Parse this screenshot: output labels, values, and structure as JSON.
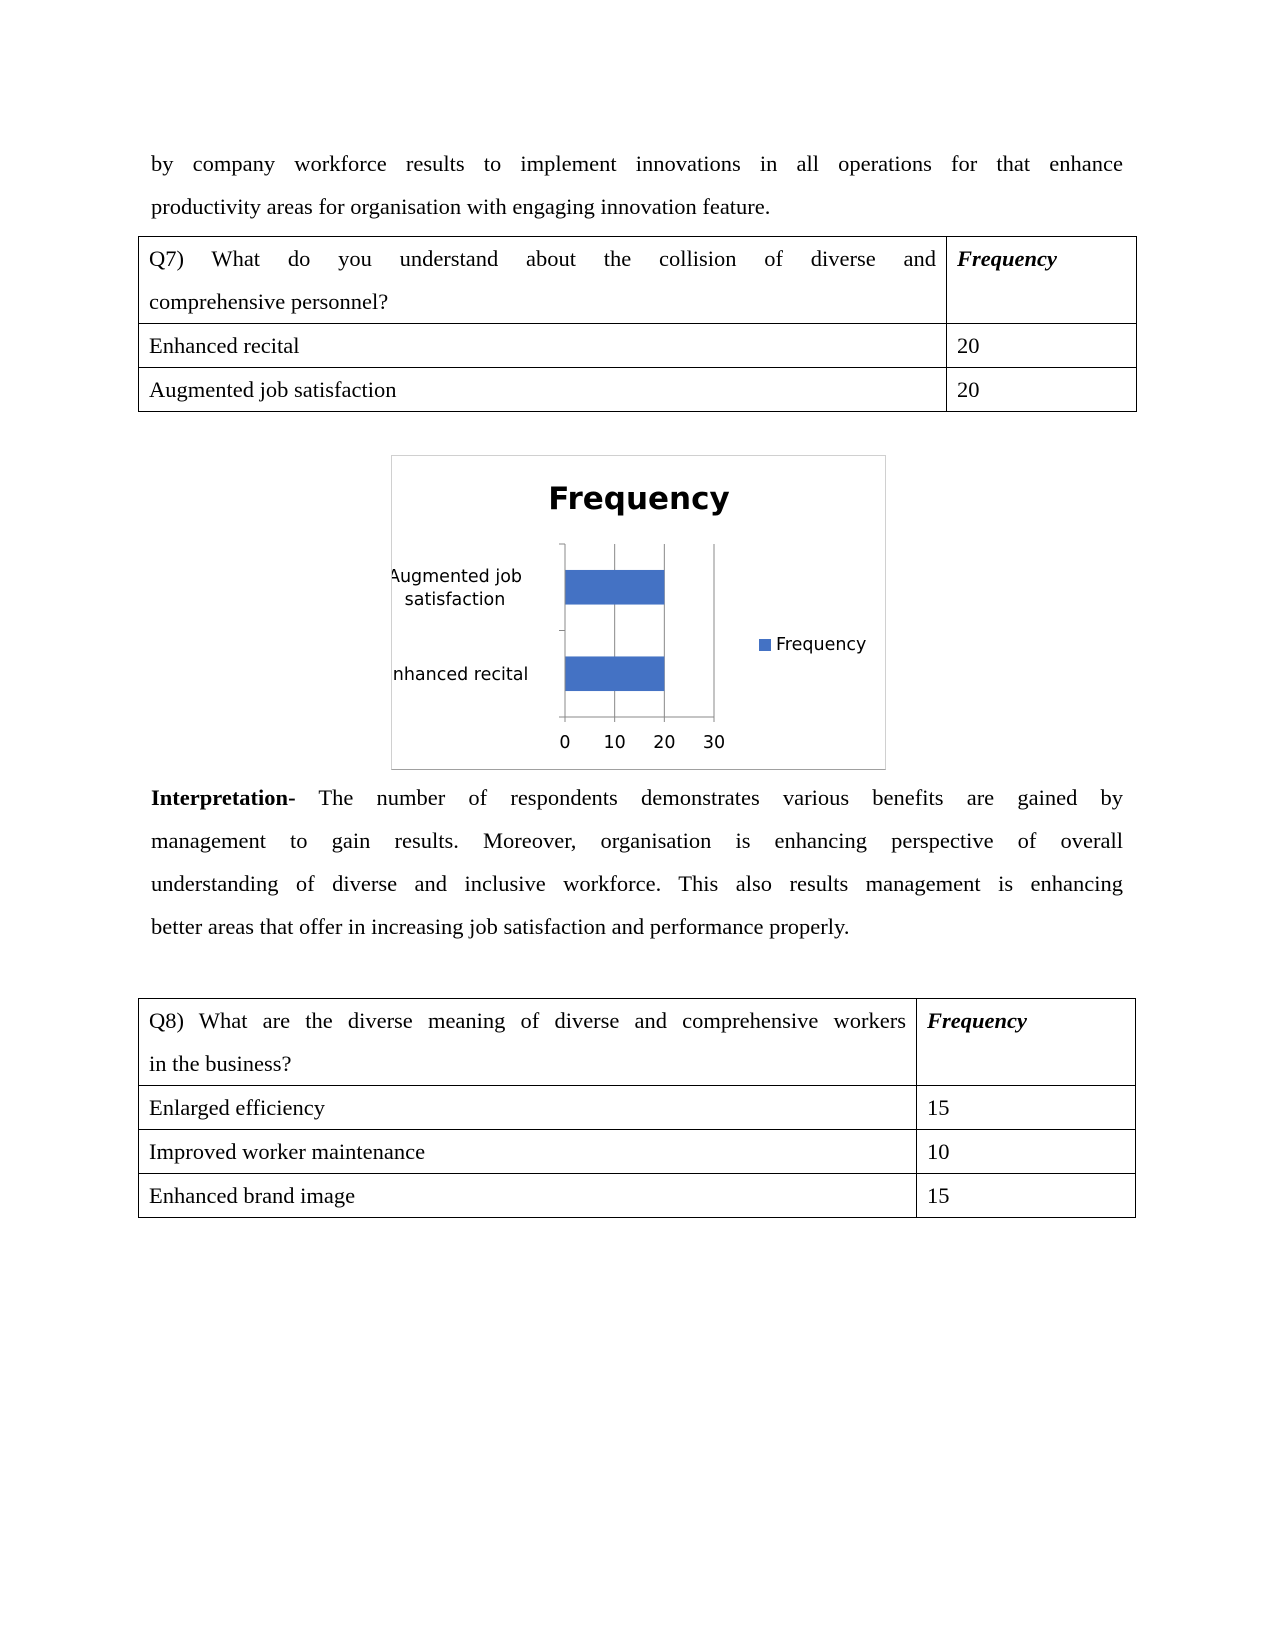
{
  "intro_paragraph": {
    "lines": [
      "by company workforce results to implement innovations in all operations for that enhance",
      "productivity areas for organisation with engaging innovation feature."
    ]
  },
  "table_q7": {
    "question_lines": [
      "Q7) What do you understand about the collision of diverse and",
      "comprehensive personnel?"
    ],
    "header_frequency": "Frequency",
    "rows": [
      {
        "label": "Enhanced recital",
        "value": "20"
      },
      {
        "label": "Augmented job satisfaction",
        "value": "20"
      }
    ]
  },
  "chart_data": {
    "type": "bar",
    "orientation": "horizontal",
    "title": "Frequency",
    "categories": [
      "Enhanced recital",
      "Augmented job satisfaction"
    ],
    "category_label_lines": [
      [
        "Enhanced recital"
      ],
      [
        "Augmented job",
        "satisfaction"
      ]
    ],
    "series": [
      {
        "name": "Frequency",
        "values": [
          20,
          20
        ],
        "color": "#4472C4"
      }
    ],
    "xlabel": "",
    "ylabel": "",
    "xlim": [
      0,
      30
    ],
    "xticks": [
      0,
      10,
      20,
      30
    ],
    "xtick_labels": [
      "0",
      "10",
      "20",
      "30"
    ],
    "grid": true,
    "legend": {
      "position": "right",
      "entries": [
        "Frequency"
      ]
    }
  },
  "interpretation": {
    "label": "Interpretation-",
    "first_line_rest": "The number of respondents demonstrates various benefits are gained by",
    "lines": [
      "management to gain results. Moreover, organisation is enhancing perspective of overall",
      "understanding of diverse and inclusive workforce. This also results management is enhancing",
      "better areas that offer in increasing job satisfaction and performance properly."
    ]
  },
  "table_q8": {
    "question_lines": [
      "Q8) What are the diverse meaning of diverse and comprehensive workers",
      "in the business?"
    ],
    "header_frequency": "Frequency",
    "rows": [
      {
        "label": "Enlarged efficiency",
        "value": "15"
      },
      {
        "label": "Improved worker maintenance",
        "value": "10"
      },
      {
        "label": "Enhanced brand image",
        "value": "15"
      }
    ]
  }
}
